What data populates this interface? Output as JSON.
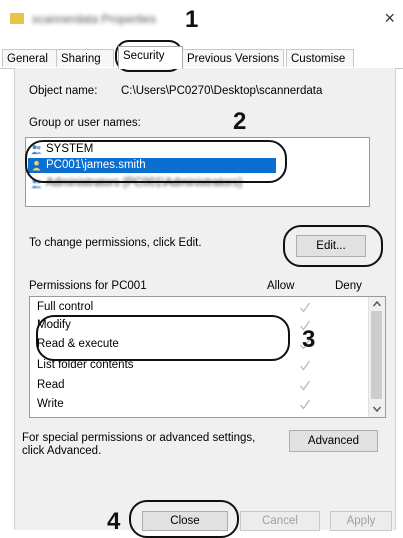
{
  "window": {
    "title": "scannerdata Properties",
    "close_glyph": "×"
  },
  "tabs": [
    {
      "label": "General",
      "active": false
    },
    {
      "label": "Sharing",
      "active": false
    },
    {
      "label": "Security",
      "active": true
    },
    {
      "label": "Previous Versions",
      "active": false
    },
    {
      "label": "Customise",
      "active": false
    }
  ],
  "security": {
    "object_name_label": "Object name:",
    "object_name_value": "C:\\Users\\PC0270\\Desktop\\scannerdata",
    "group_label": "Group or user names:",
    "users": [
      {
        "name": "SYSTEM",
        "icon": "users-icon",
        "selected": false
      },
      {
        "name": "PC001\\james.smith",
        "icon": "user-icon",
        "selected": true
      },
      {
        "name": "Administrators (PC001\\Administrators)",
        "icon": "users-icon",
        "selected": false
      }
    ],
    "change_text": "To change permissions, click Edit.",
    "edit_button": "Edit...",
    "permissions_for": "Permissions for PC001",
    "allow_header": "Allow",
    "deny_header": "Deny",
    "permissions": [
      {
        "name": "Full control",
        "allow": true
      },
      {
        "name": "Modify",
        "allow": true
      },
      {
        "name": "Read & execute",
        "allow": true
      },
      {
        "name": "List folder contents",
        "allow": true
      },
      {
        "name": "Read",
        "allow": true
      },
      {
        "name": "Write",
        "allow": true
      }
    ],
    "special_text_1": "For special permissions or advanced settings,",
    "special_text_2": "click Advanced.",
    "advanced_button": "Advanced"
  },
  "buttons": {
    "close": "Close",
    "cancel": "Cancel",
    "apply": "Apply"
  },
  "callouts": [
    "1",
    "2",
    "3",
    "4"
  ],
  "colors": {
    "selection": "#0a6fd1",
    "callout": "#111111",
    "check": "#b9b9b9"
  }
}
